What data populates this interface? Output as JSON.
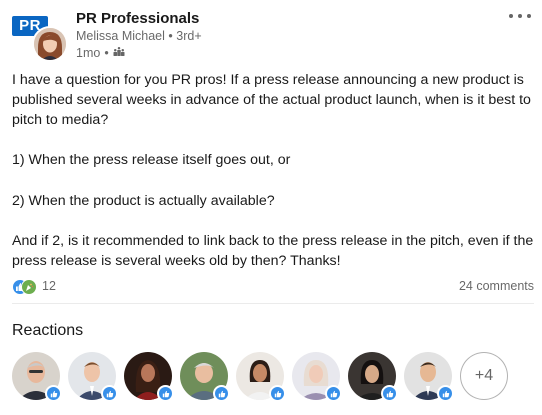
{
  "header": {
    "group_logo_text": "PR",
    "group_name": "PR Professionals",
    "author_name": "Melissa Michael",
    "separator": "•",
    "connection_degree": "3rd+",
    "time_ago": "1mo",
    "audience_icon": "group-audience-icon",
    "more_icon": "more-options-icon"
  },
  "post": {
    "paragraphs": [
      "I have a question for you PR pros! If a press release announcing a new product is published several weeks in advance of the actual product launch, when is it best to pitch to media?",
      "1) When the press release itself goes out, or",
      "2) When the product is actually available?",
      "And if 2, is it recommended to link back to the press release in the pitch, even if the press release is several weeks old by then? Thanks!"
    ]
  },
  "social": {
    "reaction_icons": [
      "like-icon",
      "celebrate-icon"
    ],
    "reaction_count": "12",
    "comments_count": "24 comments"
  },
  "reactions": {
    "heading": "Reactions",
    "more_label": "+4",
    "reactor_badge_icon": "like-icon"
  },
  "colors": {
    "brand_blue": "#0a66c2",
    "like_blue": "#378fe9",
    "celebrate_green": "#6dae4f",
    "secondary_text": "rgba(0,0,0,0.6)"
  }
}
